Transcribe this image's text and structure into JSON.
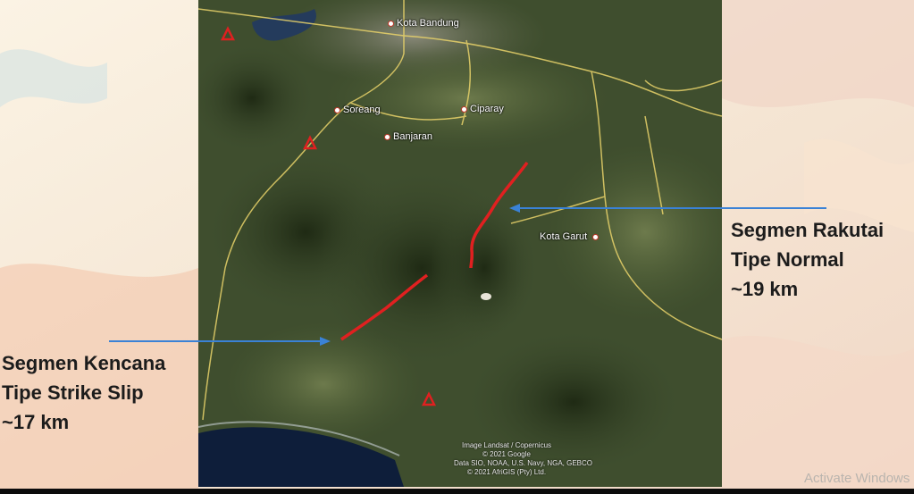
{
  "map": {
    "places": [
      {
        "name": "Kota Bandung"
      },
      {
        "name": "Soreang"
      },
      {
        "name": "Ciparay"
      },
      {
        "name": "Banjaran"
      },
      {
        "name": "Kota Garut"
      }
    ],
    "attribution": [
      "Image Landsat / Copernicus",
      "© 2021 Google",
      "Data SIO, NOAA, U.S. Navy, NGA, GEBCO",
      "© 2021 AfriGIS (Pty) Ltd."
    ],
    "fault_color": "#e02020",
    "arrow_color": "#3a82d6",
    "marker_icon": "volcano-triangle-icon"
  },
  "callouts": {
    "rakutai": {
      "line1": "Segmen Rakutai",
      "line2": "Tipe Normal",
      "line3": "~19 km"
    },
    "kencana": {
      "line1": "Segmen Kencana",
      "line2": "Tipe Strike Slip",
      "line3": "~17 km"
    }
  },
  "watermark": "Activate Windows"
}
